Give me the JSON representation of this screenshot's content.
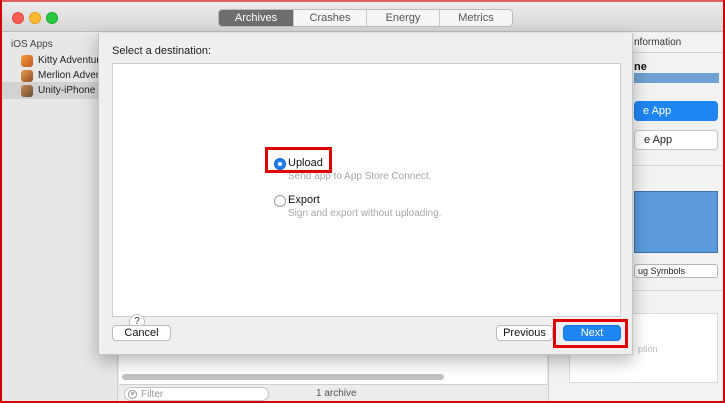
{
  "window": {
    "tabs": [
      {
        "label": "Archives",
        "active": true
      },
      {
        "label": "Crashes",
        "active": false
      },
      {
        "label": "Energy",
        "active": false
      },
      {
        "label": "Metrics",
        "active": false
      }
    ]
  },
  "sidebar": {
    "header": "iOS Apps",
    "items": [
      {
        "label": "Kitty Adventure",
        "icon": "kitty-app-icon",
        "selected": false
      },
      {
        "label": "Merlion Adventure",
        "icon": "merlion-app-icon",
        "selected": false
      },
      {
        "label": "Unity-iPhone",
        "icon": "unity-app-icon",
        "selected": true
      }
    ]
  },
  "main": {
    "filter_placeholder": "Filter",
    "archive_count": "1 archive"
  },
  "right_panel": {
    "header": "nformation",
    "name": "ne",
    "primary_button": "e App",
    "secondary_button": "e App",
    "debug_button": "ug Symbols",
    "description_placeholder": "ption"
  },
  "sheet": {
    "title": "Select a destination:",
    "options": [
      {
        "label": "Upload",
        "description": "Send app to App Store Connect.",
        "selected": true
      },
      {
        "label": "Export",
        "description": "Sign and export without uploading.",
        "selected": false
      }
    ],
    "help_label": "?",
    "cancel_label": "Cancel",
    "previous_label": "Previous",
    "next_label": "Next"
  },
  "colors": {
    "accent_blue": "#1f85f2",
    "highlight_red": "#e00000"
  }
}
